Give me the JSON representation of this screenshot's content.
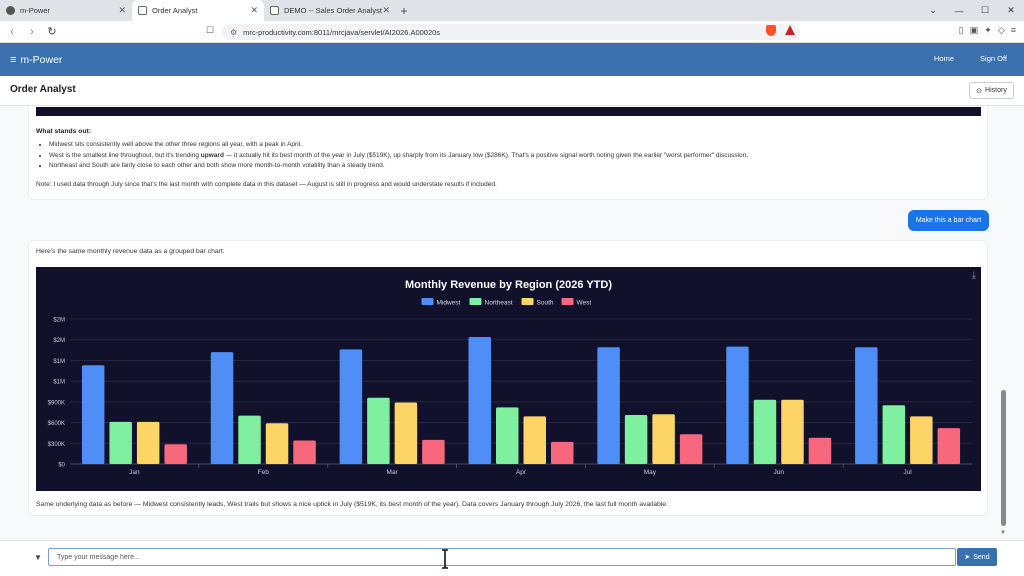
{
  "browser": {
    "tabs": [
      {
        "title": "m-Power",
        "active": false
      },
      {
        "title": "Order Analyst",
        "active": true
      },
      {
        "title": "DEMO -- Sales Order Analyst",
        "active": false
      }
    ],
    "url": "mrc-productivity.com:8011/mrcjava/servlet/AI2026.A00020s"
  },
  "app": {
    "brand": "m-Power",
    "nav": {
      "home": "Home",
      "signoff": "Sign Off"
    },
    "page_title": "Order Analyst",
    "history_label": "History"
  },
  "chat": {
    "prev_message": {
      "heading": "What stands out:",
      "bullets": [
        {
          "parts": [
            "Midwest sits consistently well above the other three regions all year, with a peak in April."
          ]
        },
        {
          "parts": [
            "West is the smallest line throughout, but it's trending ",
            "upward",
            " — it actually hit its best month of the year in July ($519K), up sharply from its January low ($286K). That's a positive signal worth noting given the earlier \"worst performer\" discussion."
          ]
        },
        {
          "parts": [
            "Northeast and South are fairly close to each other and both show more month-to-month volatility than a steady trend."
          ]
        }
      ],
      "note": "Note: I used data through July since that's the last month with complete data in this dataset — August is still in progress and would understate results if included."
    },
    "user_message": "Make this a bar chart",
    "reply": {
      "intro": "Here's the same monthly revenue data as a grouped bar chart:",
      "outro": "Same underlying data as before — Midwest consistently leads, West trails but shows a nice uptick in July ($519K, its best month of the year). Data covers January through July 2026, the last full month available."
    },
    "input_placeholder": "Type your message here...",
    "send_label": "Send"
  },
  "colors": {
    "app_header": "#3a70ad",
    "chart_bg": "#12112c",
    "send_button": "#3a70ad",
    "user_bubble": "#1a73e8"
  },
  "chart_data": {
    "type": "bar",
    "title": "Monthly Revenue by Region (2026 YTD)",
    "categories": [
      "Jan",
      "Feb",
      "Mar",
      "Apr",
      "May",
      "Jun",
      "Jul"
    ],
    "y_tick_labels": [
      "$0",
      "$300K",
      "$600K",
      "$900K",
      "$1M",
      "$1M",
      "$2M",
      "$2M"
    ],
    "ylim": [
      0,
      2100000
    ],
    "legend_position": "top",
    "grid": true,
    "series": [
      {
        "name": "Midwest",
        "color": "#4f8ef7",
        "values": [
          1430000,
          1620000,
          1660000,
          1840000,
          1690000,
          1700000,
          1690000
        ]
      },
      {
        "name": "Northeast",
        "color": "#7ef0a0",
        "values": [
          610000,
          700000,
          960000,
          820000,
          710000,
          930000,
          850000
        ]
      },
      {
        "name": "South",
        "color": "#fdd466",
        "values": [
          610000,
          590000,
          890000,
          690000,
          720000,
          930000,
          690000
        ]
      },
      {
        "name": "West",
        "color": "#f7687d",
        "values": [
          286000,
          340000,
          350000,
          320000,
          430000,
          380000,
          519000
        ]
      }
    ]
  }
}
